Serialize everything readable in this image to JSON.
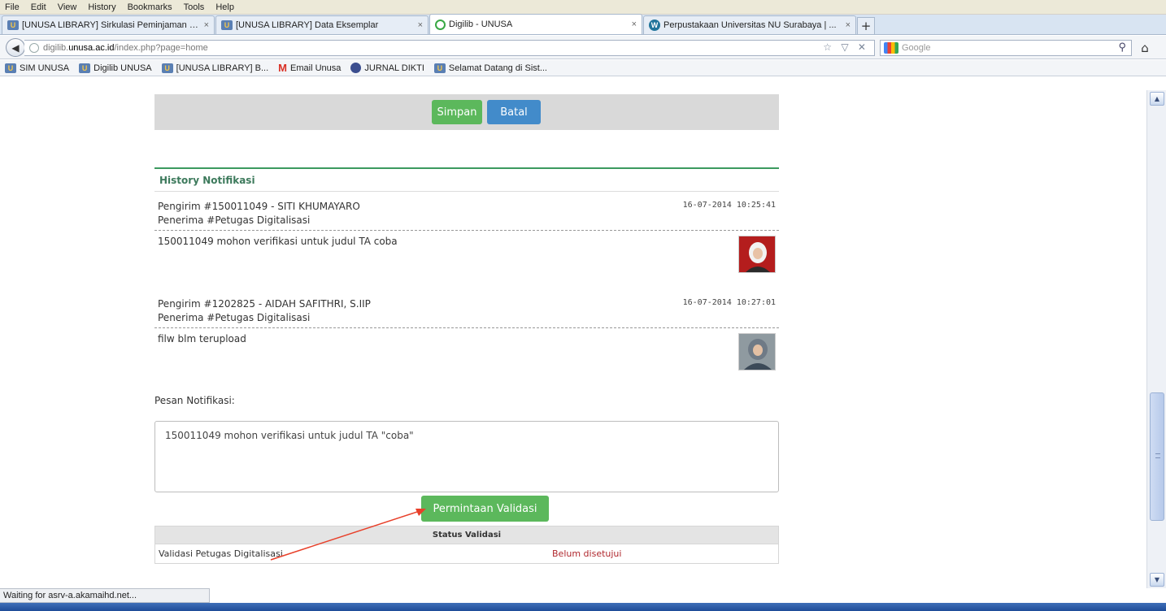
{
  "menu": [
    "File",
    "Edit",
    "View",
    "History",
    "Bookmarks",
    "Tools",
    "Help"
  ],
  "tabs": [
    {
      "label": "[UNUSA LIBRARY] Sirkulasi Peminjaman P...",
      "icon": "unusa-icon",
      "active": false
    },
    {
      "label": "[UNUSA LIBRARY] Data Eksemplar",
      "icon": "unusa-icon",
      "active": false
    },
    {
      "label": "Digilib - UNUSA",
      "icon": "loading-ring-icon",
      "active": true
    },
    {
      "label": "Perpustakaan Universitas NU Surabaya | ...",
      "icon": "wordpress-icon",
      "active": false
    }
  ],
  "tab_close": "×",
  "new_tab": "+",
  "address": {
    "prefix": "digilib.",
    "host": "unusa.ac.id",
    "path": "/index.php?page=home"
  },
  "url_actions": "☆ ▽ ✕",
  "search": {
    "placeholder": "Google"
  },
  "bookmarks": [
    {
      "label": "SIM UNUSA",
      "icon": "unusa-icon"
    },
    {
      "label": "Digilib UNUSA",
      "icon": "unusa-icon"
    },
    {
      "label": "[UNUSA LIBRARY] B...",
      "icon": "unusa-icon"
    },
    {
      "label": "Email Unusa",
      "icon": "gmail-icon"
    },
    {
      "label": "JURNAL DIKTI",
      "icon": "dikti-icon"
    },
    {
      "label": "Selamat Datang di Sist...",
      "icon": "unusa-icon"
    }
  ],
  "form": {
    "save_label": "Simpan",
    "cancel_label": "Batal"
  },
  "history": {
    "title": "History Notifikasi",
    "messages": [
      {
        "sender": "Pengirim #150011049 - SITI KHUMAYARO",
        "receiver": "Penerima #Petugas Digitalisasi",
        "time": "16-07-2014 10:25:41",
        "body": "150011049 mohon verifikasi untuk judul TA coba"
      },
      {
        "sender": "Pengirim #1202825 - AIDAH SAFITHRI, S.IIP",
        "receiver": "Penerima #Petugas Digitalisasi",
        "time": "16-07-2014 10:27:01",
        "body": "filw blm terupload"
      }
    ]
  },
  "pesan": {
    "label": "Pesan Notifikasi:",
    "value": "150011049 mohon verifikasi untuk judul TA \"coba\""
  },
  "validation_button": "Permintaan Validasi",
  "status_table": {
    "header": "Status Validasi",
    "rows": [
      {
        "name": "Validasi Petugas Digitalisasi",
        "status": "Belum disetujui"
      }
    ]
  },
  "statusbar": "Waiting for asrv-a.akamaihd.net...",
  "colors": {
    "green": "#5cb85c",
    "blue": "#428bca",
    "status_red": "#b0282e",
    "section_green": "#3c9a5f",
    "annotation_arrow": "#e8402a"
  }
}
